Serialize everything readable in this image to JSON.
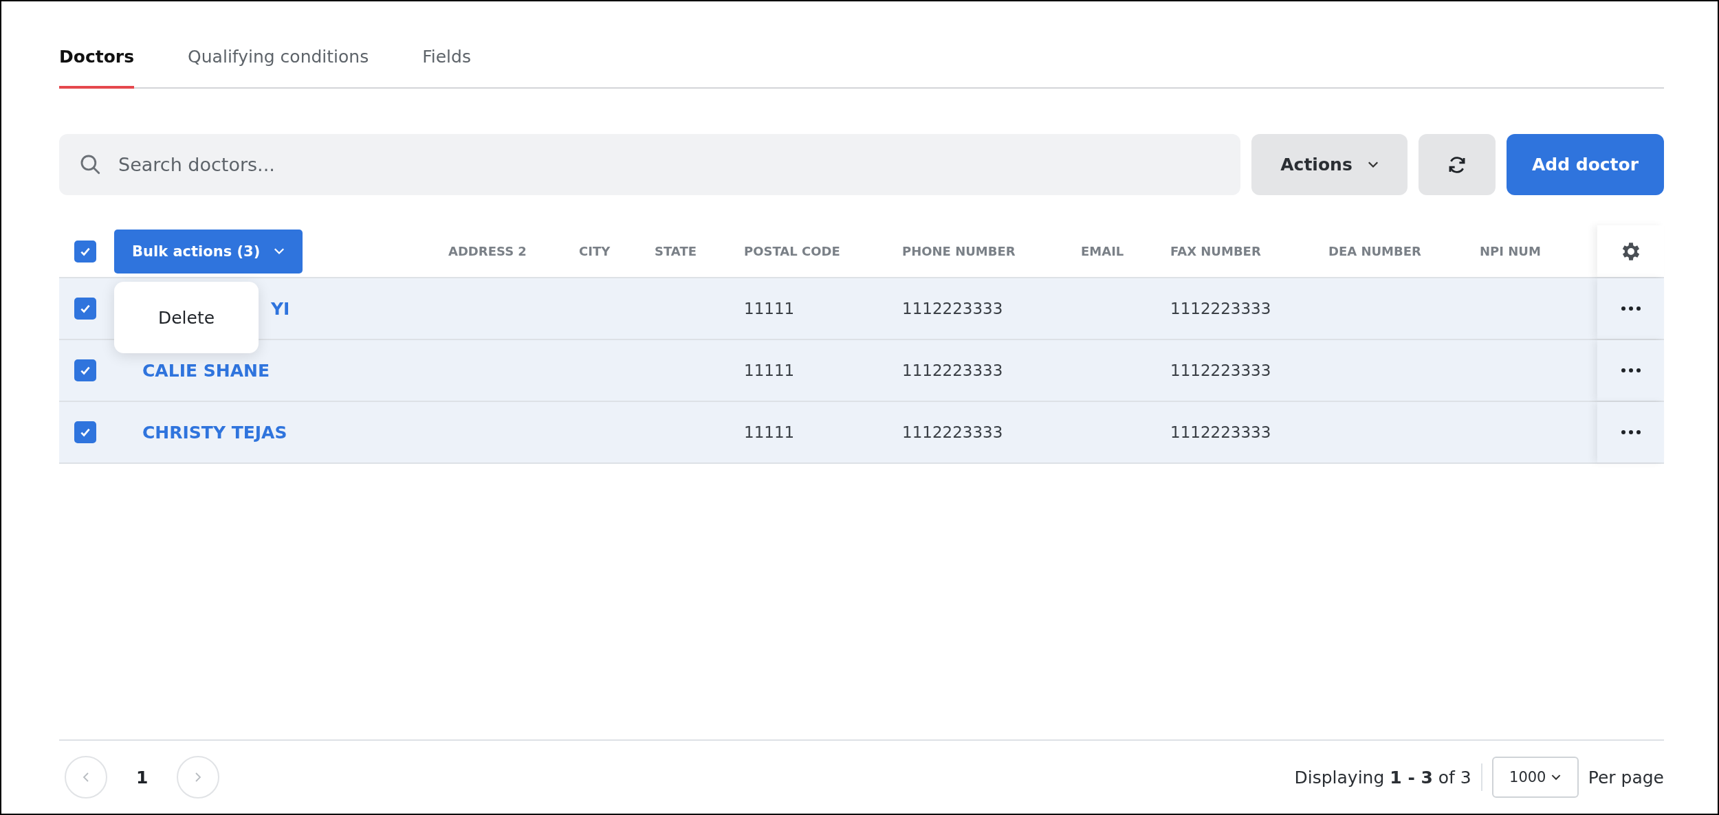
{
  "tabs": [
    {
      "label": "Doctors",
      "selected": true
    },
    {
      "label": "Qualifying conditions",
      "selected": false
    },
    {
      "label": "Fields",
      "selected": false
    }
  ],
  "toolbar": {
    "search": {
      "placeholder": "Search doctors..."
    },
    "actions_label": "Actions",
    "add_label": "Add doctor"
  },
  "table": {
    "select_all": {
      "checked": true
    },
    "bulk_actions": {
      "label": "Bulk actions (3)",
      "menu": [
        "Delete"
      ]
    },
    "columns": [
      "ADDRESS 2",
      "CITY",
      "STATE",
      "POSTAL CODE",
      "PHONE NUMBER",
      "EMAIL",
      "FAX NUMBER",
      "DEA NUMBER",
      "NPI NUM"
    ],
    "rows": [
      {
        "checked": true,
        "name": "YI",
        "partly_hidden": true,
        "cells": [
          null,
          null,
          null,
          "11111",
          "1112223333",
          null,
          "1112223333",
          null,
          null
        ]
      },
      {
        "checked": true,
        "name": "CALIE SHANE",
        "partly_hidden": false,
        "cells": [
          null,
          null,
          null,
          "11111",
          "1112223333",
          null,
          "1112223333",
          null,
          null
        ]
      },
      {
        "checked": true,
        "name": "CHRISTY TEJAS",
        "partly_hidden": false,
        "cells": [
          null,
          null,
          null,
          "11111",
          "1112223333",
          null,
          "1112223333",
          null,
          null
        ]
      }
    ]
  },
  "pagination": {
    "page": "1",
    "displaying": "Displaying **1 - 3** of 3",
    "per_page": "1000",
    "per_page_label": "Per page"
  }
}
